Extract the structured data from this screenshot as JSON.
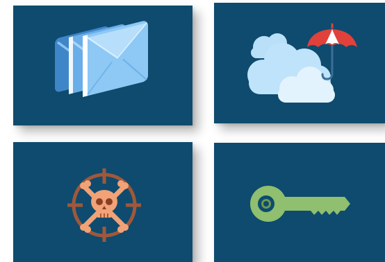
{
  "tiles": [
    {
      "id": "mail",
      "icon": "envelopes-icon",
      "background": "#0e4b6e"
    },
    {
      "id": "weather",
      "icon": "cloud-umbrella-icon",
      "background": "#0e4b6e"
    },
    {
      "id": "threat",
      "icon": "skull-crosshair-icon",
      "background": "#0e4b6e"
    },
    {
      "id": "security",
      "icon": "key-icon",
      "background": "#0e4b6e"
    }
  ],
  "colors": {
    "tile_bg": "#0e4b6e",
    "envelope_blue": "#5fa8e6",
    "cloud_light": "#cfe9fb",
    "umbrella_red": "#e0413a",
    "skull_orange": "#f1a277",
    "crosshair_brown": "#a0583a",
    "key_green": "#8fbf6f"
  }
}
